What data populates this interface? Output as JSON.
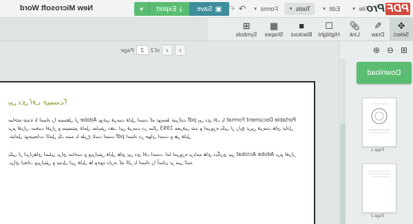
{
  "app": {
    "logo_pdf": "PDF",
    "logo_pro": "Pro",
    "document_title": "New Microsoft Word"
  },
  "menus": {
    "file": "File",
    "edit": "Edit",
    "tools": "Tools",
    "forms": "Forms"
  },
  "toolbar": {
    "save_label": "Save",
    "export_label": "Export"
  },
  "tools": {
    "select": "Select",
    "draw": "Draw",
    "link": "Link",
    "highlight": "Highlight",
    "blackout": "Blackout",
    "shapes": "Shapes",
    "symbols": "Symbols"
  },
  "sidebar": {
    "download_label": "Download",
    "thumbnails": [
      {
        "label": "Page 1"
      },
      {
        "label": "Page 2"
      }
    ]
  },
  "pagenav": {
    "page_label": "Page:",
    "current_page": "2",
    "of_label": "of 2"
  },
  "document": {
    "heading": "پی دی اف چیست؟",
    "para1": "Portable Document Format پی دی اف یا pdf نوعی فرمت فایل است که توسط شرکت Adobe ساخته شده تا اسناد را مستقل از نرم افزار، سخت افزار و سیستم عامل نمایش دهد. این فرمت در سال 1993 معرفی شد و امروزه یکی از رایج ترین فرمت های تبادل اسناد در جهان است و هر فایل pdf شامل توضیحات کامل یک سند با طرح ثابت است.",
    "para2": "نرم افزار Adobe Acrobat یکی از ابزارهای اصلی برای ساخت و ویرایش فایل های پی دی اف است، اما امروزه برنامه های دیگری نیز برای ایجاد، ویرایش و تبدیل این فایل ها وجود دارند که کار با اسناد را آسان تر می کنند."
  }
}
